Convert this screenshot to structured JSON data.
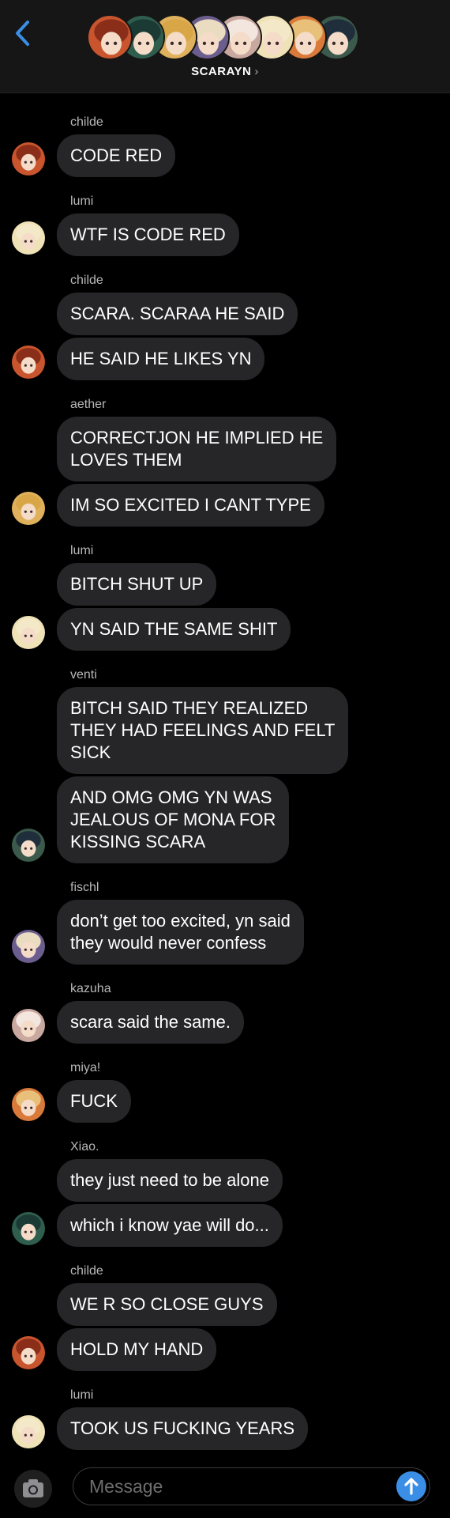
{
  "header": {
    "title": "SCARAYN",
    "chevron": "›",
    "members": [
      {
        "icon": "childe-avatar-icon",
        "color": "#c8552d"
      },
      {
        "icon": "xiao-avatar-icon",
        "color": "#2f5d4e"
      },
      {
        "icon": "aether-avatar-icon",
        "color": "#e0b15c"
      },
      {
        "icon": "fischl-avatar-icon",
        "color": "#6b5d8e"
      },
      {
        "icon": "kazuha-avatar-icon",
        "color": "#c9a8a0"
      },
      {
        "icon": "lumi-avatar-icon",
        "color": "#efe2b6"
      },
      {
        "icon": "miya-avatar-icon",
        "color": "#d97a3a"
      },
      {
        "icon": "venti-avatar-icon",
        "color": "#3b5a4c"
      }
    ]
  },
  "messages": [
    {
      "sender": "childe",
      "bubbles": [
        "CODE RED"
      ]
    },
    {
      "sender": "lumi",
      "bubbles": [
        "WTF IS CODE RED"
      ]
    },
    {
      "sender": "childe",
      "bubbles": [
        "SCARA. SCARAA HE SAID",
        "HE SAID HE LIKES YN"
      ]
    },
    {
      "sender": "aether",
      "bubbles": [
        "CORRECTJON HE IMPLIED HE\nLOVES THEM",
        "IM SO EXCITED I CANT TYPE"
      ]
    },
    {
      "sender": "lumi",
      "bubbles": [
        "BITCH SHUT UP",
        "YN SAID THE SAME SHIT"
      ]
    },
    {
      "sender": "venti",
      "bubbles": [
        "BITCH SAID THEY REALIZED\nTHEY HAD FEELINGS AND FELT\nSICK",
        "AND OMG OMG YN WAS\nJEALOUS OF MONA FOR\nKISSING SCARA"
      ]
    },
    {
      "sender": "fischl",
      "bubbles": [
        "don’t get too excited, yn said\nthey would never confess"
      ]
    },
    {
      "sender": "kazuha",
      "bubbles": [
        "scara said the same."
      ]
    },
    {
      "sender": "miya!",
      "bubbles": [
        "FUCK"
      ]
    },
    {
      "sender": "Xiao.",
      "bubbles": [
        "they just need to be alone",
        "which i know yae will do..."
      ]
    },
    {
      "sender": "childe",
      "bubbles": [
        "WE R SO CLOSE GUYS",
        "HOLD MY HAND"
      ]
    },
    {
      "sender": "lumi",
      "bubbles": [
        "TOOK US FUCKING YEARS"
      ]
    }
  ],
  "avatars": {
    "childe": {
      "icon": "childe-avatar-icon",
      "color": "#c8552d",
      "hair": "#8a2e1a"
    },
    "lumi": {
      "icon": "lumi-avatar-icon",
      "color": "#efe2b6",
      "hair": "#f3e9c8"
    },
    "aether": {
      "icon": "aether-avatar-icon",
      "color": "#e0b15c",
      "hair": "#d9a647"
    },
    "venti": {
      "icon": "venti-avatar-icon",
      "color": "#3b5a4c",
      "hair": "#1f2e3a"
    },
    "fischl": {
      "icon": "fischl-avatar-icon",
      "color": "#6b5d8e",
      "hair": "#e9dcc0"
    },
    "kazuha": {
      "icon": "kazuha-avatar-icon",
      "color": "#c9a8a0",
      "hair": "#f2e6df"
    },
    "miya!": {
      "icon": "miya-avatar-icon",
      "color": "#d97a3a",
      "hair": "#e8c07a"
    },
    "Xiao.": {
      "icon": "xiao-avatar-icon",
      "color": "#2f5d4e",
      "hair": "#1c3a34"
    }
  },
  "composer": {
    "placeholder": "Message",
    "camera_icon": "camera-icon",
    "send_icon": "send-arrow-icon"
  },
  "colors": {
    "accent": "#3a8ee6",
    "bubble": "#262628",
    "background": "#000000"
  }
}
